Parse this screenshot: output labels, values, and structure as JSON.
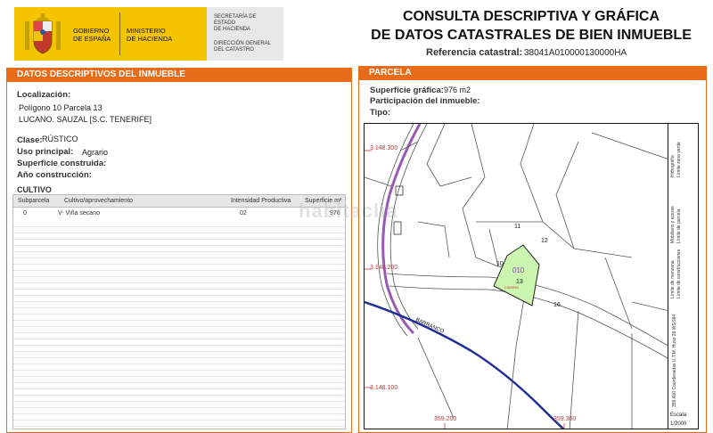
{
  "header": {
    "gob_line1": "GOBIERNO",
    "gob_line2": "DE ESPAÑA",
    "min_line1": "MINISTERIO",
    "min_line2": "DE HACIENDA",
    "sec_line1": "SECRETARÍA DE ESTADO",
    "sec_line2": "DE HACIENDA",
    "dir_line1": "DIRECCIÓN GENERAL",
    "dir_line2": "DEL CATASTRO",
    "title_line1": "CONSULTA DESCRIPTIVA Y GRÁFICA",
    "title_line2": "DE DATOS CATASTRALES DE BIEN INMUEBLE",
    "ref_label": "Referencia catastral:",
    "ref_value": "38041A010000130000HA"
  },
  "left": {
    "section_title": "DATOS DESCRIPTIVOS DEL INMUEBLE",
    "localizacion_label": "Localización:",
    "localizacion_line1": "Polígono 10 Parcela 13",
    "localizacion_line2": "LUCANO. SAUZAL [S.C. TENERIFE]",
    "clase_label": "Clase:",
    "clase_value": "RÚSTICO",
    "uso_label": "Uso principal:",
    "uso_value": "Agrario",
    "sup_construida_label": "Superficie construida:",
    "anio_label": "Año construcción:",
    "cultivo_title": "CULTIVO",
    "table_headers": [
      "Subparcela",
      "Cultivo/aprovechamiento",
      "Intensidad Productiva",
      "Superficie m²"
    ],
    "table_rows": [
      [
        "0",
        "V- Viña secano",
        "02",
        "976"
      ]
    ]
  },
  "right": {
    "section_title": "PARCELA",
    "sup_grafica_label": "Superficie gráfica:",
    "sup_grafica_value": "976 m2",
    "participacion_label": "Participación del inmueble:",
    "tipo_label": "Tipo:"
  },
  "map": {
    "coord_y1": "3.148.300",
    "coord_y2": "3.148.200",
    "coord_y3": "3.148.100",
    "coord_x1": "359.200",
    "coord_x2": "359.300",
    "parcel_numbers": [
      "11",
      "12",
      "10",
      "13",
      "16"
    ],
    "subparcel_label": "010",
    "camino_label": "CAMINO",
    "barranco_label": "BARRANCO",
    "escala_label": "Escala:",
    "escala_value": "1/2000",
    "legend": {
      "hidrografia": "Hidrografía",
      "limite_zona_verde": "Límite zona verde",
      "mobiliario": "Mobiliario y aceras",
      "limite_parcela": "Límite de parcela",
      "limite_construcciones": "Límite de construcciones",
      "limite_manzana": "Límite de manzana",
      "coords": "359.400 Coordenadas U.T.M. Huso 28 WGS84"
    }
  },
  "watermark": "habitaclia",
  "colors": {
    "orange": "#e86b1a",
    "yellow": "#f5c400",
    "parcel_green": "#ccf5b0"
  }
}
